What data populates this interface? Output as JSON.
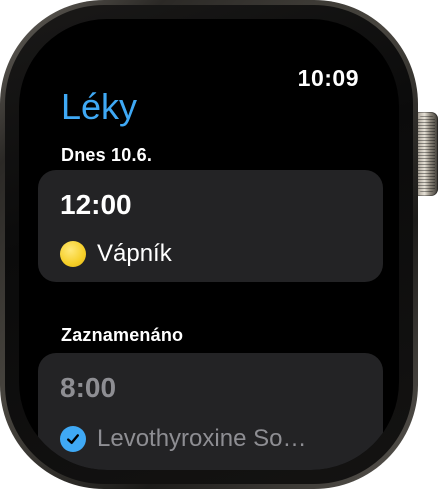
{
  "status_bar": {
    "time": "10:09"
  },
  "app": {
    "title": "Léky"
  },
  "today": {
    "label": "Dnes 10.6.",
    "time": "12:00",
    "medication": "Vápník",
    "icon": "yellow-pill-dot-icon",
    "icon_color": "#f6cf28"
  },
  "logged": {
    "label": "Zaznamenáno",
    "time": "8:00",
    "medication": "Levothyroxine So…",
    "icon": "checkmark-icon",
    "icon_color": "#3fa9f5"
  },
  "colors": {
    "accent": "#3fa9f5",
    "card_background": "#232325",
    "muted_text": "#8e8e93"
  }
}
